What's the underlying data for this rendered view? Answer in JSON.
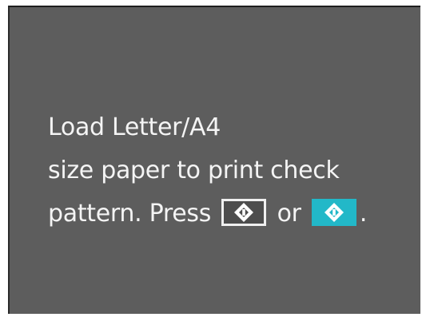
{
  "message": {
    "line1": "Load Letter/A4",
    "line2": "size paper to print check",
    "line3_prefix": "pattern. Press",
    "or_text": "or",
    "period": "."
  },
  "icons": {
    "bw_start": "bw-start-button-icon",
    "color_start": "color-start-button-icon"
  },
  "colors": {
    "screen_background": "#5d5d5d",
    "text": "#f4f4f4",
    "color_start_accent": "#22b8c8"
  }
}
